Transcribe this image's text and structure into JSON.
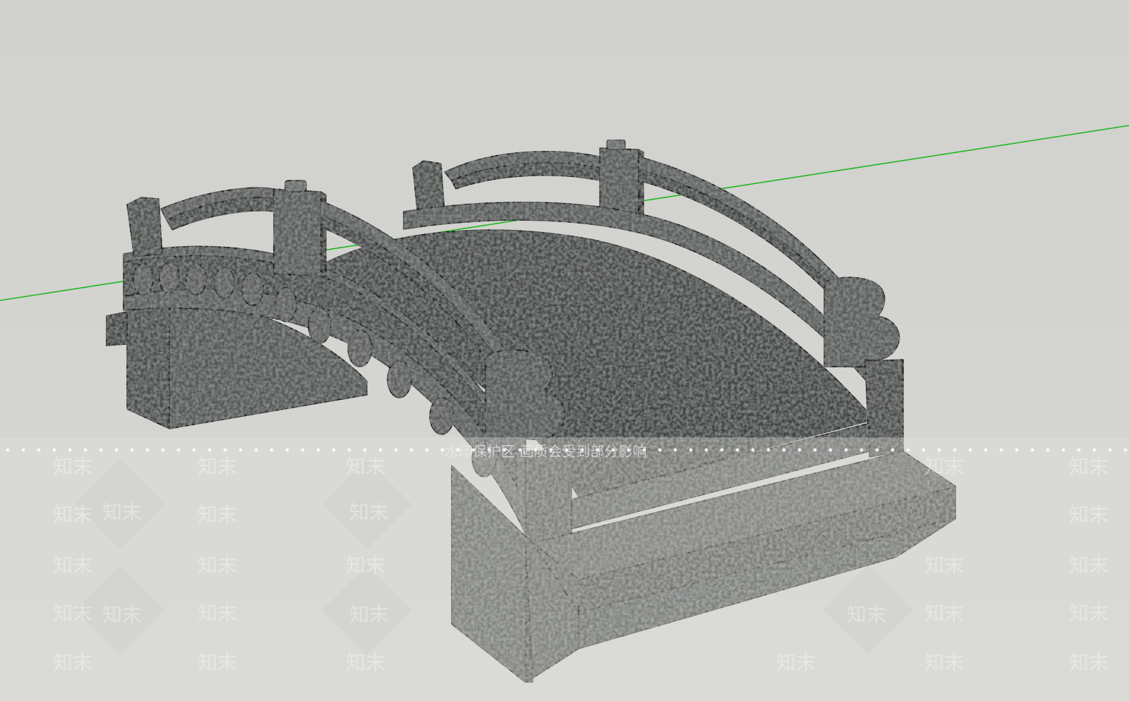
{
  "viewport": {
    "background": "#d4d4d0",
    "axis_color": "#1fb71f"
  },
  "model": {
    "stone_dark": "#3c3f3d",
    "stone_mid": "#5a5d5b",
    "stone_light": "#7a7d7b",
    "edge_color": "#111111"
  },
  "watermark": {
    "notice": "水印保护区 画质会受到部分影响",
    "tile_text": "知末"
  }
}
